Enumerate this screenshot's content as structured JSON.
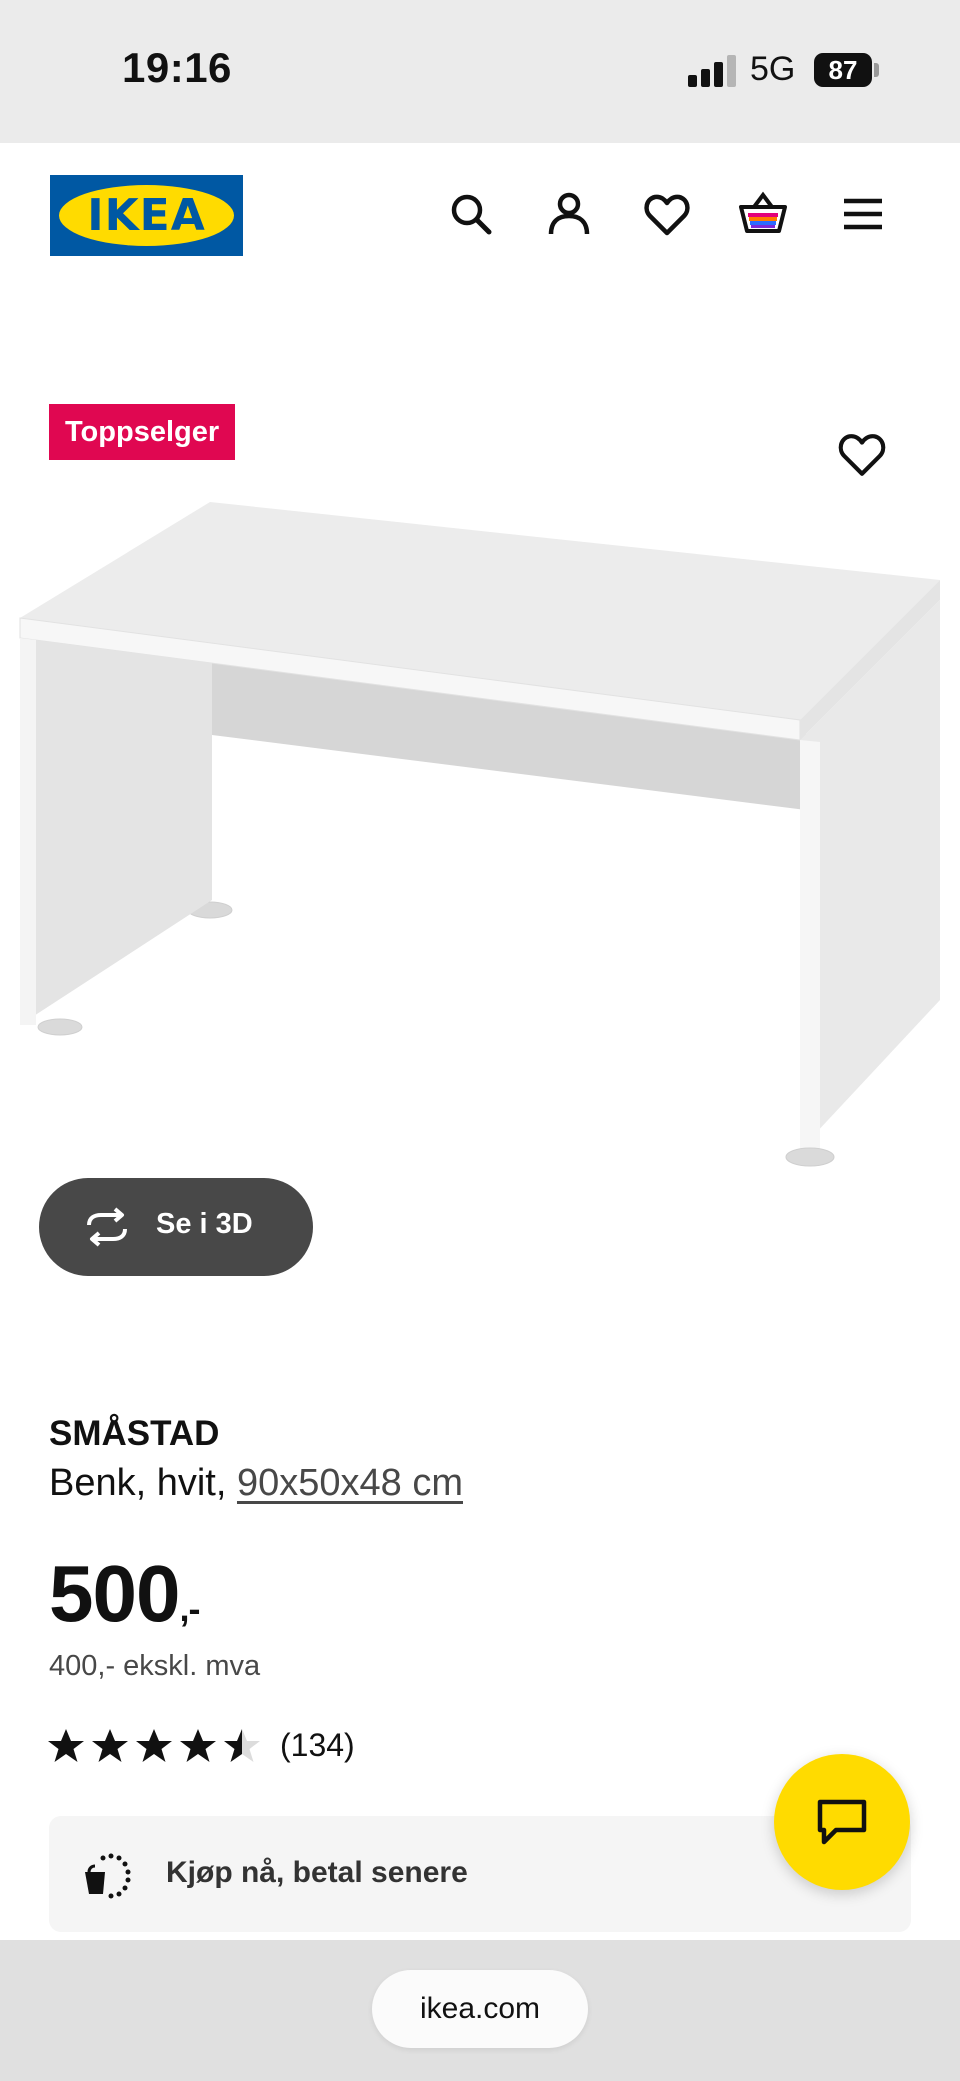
{
  "status_bar": {
    "time": "19:16",
    "network": "5G",
    "battery": "87"
  },
  "header": {
    "logo_text": "IKEA",
    "icons": [
      "search-icon",
      "user-icon",
      "heart-icon",
      "cart-icon",
      "menu-icon"
    ]
  },
  "product": {
    "badge": "Toppselger",
    "name": "SMÅSTAD",
    "description": "Benk, hvit, ",
    "dimensions": "90x50x48 cm",
    "price": "500",
    "price_suffix": ",-",
    "price_ex_vat": "400,- ekskl. mva",
    "rating": 4.5,
    "rating_max": 5,
    "review_count": "(134)",
    "view_3d_label": "Se i 3D"
  },
  "klarna": {
    "label": "Kjøp nå, betal senere"
  },
  "browser": {
    "url": "ikea.com"
  },
  "colors": {
    "ikea_blue": "#0058a3",
    "ikea_yellow": "#ffdb00",
    "badge_red": "#e00751",
    "button_dark": "#484848"
  }
}
